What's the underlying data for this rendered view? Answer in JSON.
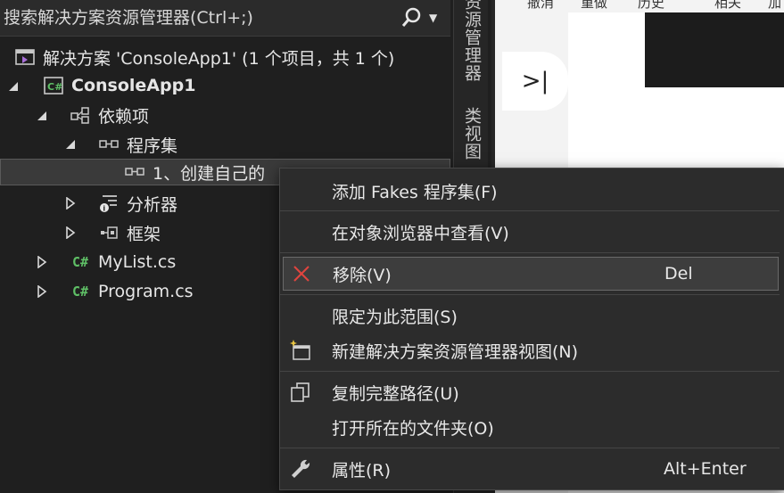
{
  "explorer": {
    "search_placeholder": "搜索解决方案资源管理器(Ctrl+;)",
    "solution_label": "解决方案 'ConsoleApp1' (1 个项目，共 1 个)",
    "project_label": "ConsoleApp1",
    "dependencies_label": "依赖项",
    "assemblies_label": "程序集",
    "assembly_item_label": "1、创建自己的",
    "analyzers_label": "分析器",
    "frameworks_label": "框架",
    "file1_label": "MyList.cs",
    "file2_label": "Program.cs",
    "cs_badge": "C#"
  },
  "vertical_tabs": {
    "solution_explorer": "资源管理器",
    "class_view": "类视图"
  },
  "editor": {
    "top_labels": [
      "撤消",
      "重做",
      "历史",
      "相关",
      "加"
    ],
    "collapse_glyph": ">|"
  },
  "context_menu": {
    "items": [
      {
        "label": "添加 Fakes 程序集(F)",
        "shortcut": ""
      },
      {
        "label": "在对象浏览器中查看(V)",
        "shortcut": ""
      },
      {
        "label": "移除(V)",
        "shortcut": "Del",
        "icon": "remove-x-icon"
      },
      {
        "label": "限定为此范围(S)",
        "shortcut": ""
      },
      {
        "label": "新建解决方案资源管理器视图(N)",
        "shortcut": "",
        "icon": "new-view-icon"
      },
      {
        "label": "复制完整路径(U)",
        "shortcut": "",
        "icon": "copy-icon"
      },
      {
        "label": "打开所在的文件夹(O)",
        "shortcut": ""
      },
      {
        "label": "属性(R)",
        "shortcut": "Alt+Enter",
        "icon": "wrench-icon"
      }
    ]
  },
  "colors": {
    "remove_icon": "#e0443e",
    "cs_green": "#5fbf66",
    "vs_purple": "#a86fd8"
  }
}
